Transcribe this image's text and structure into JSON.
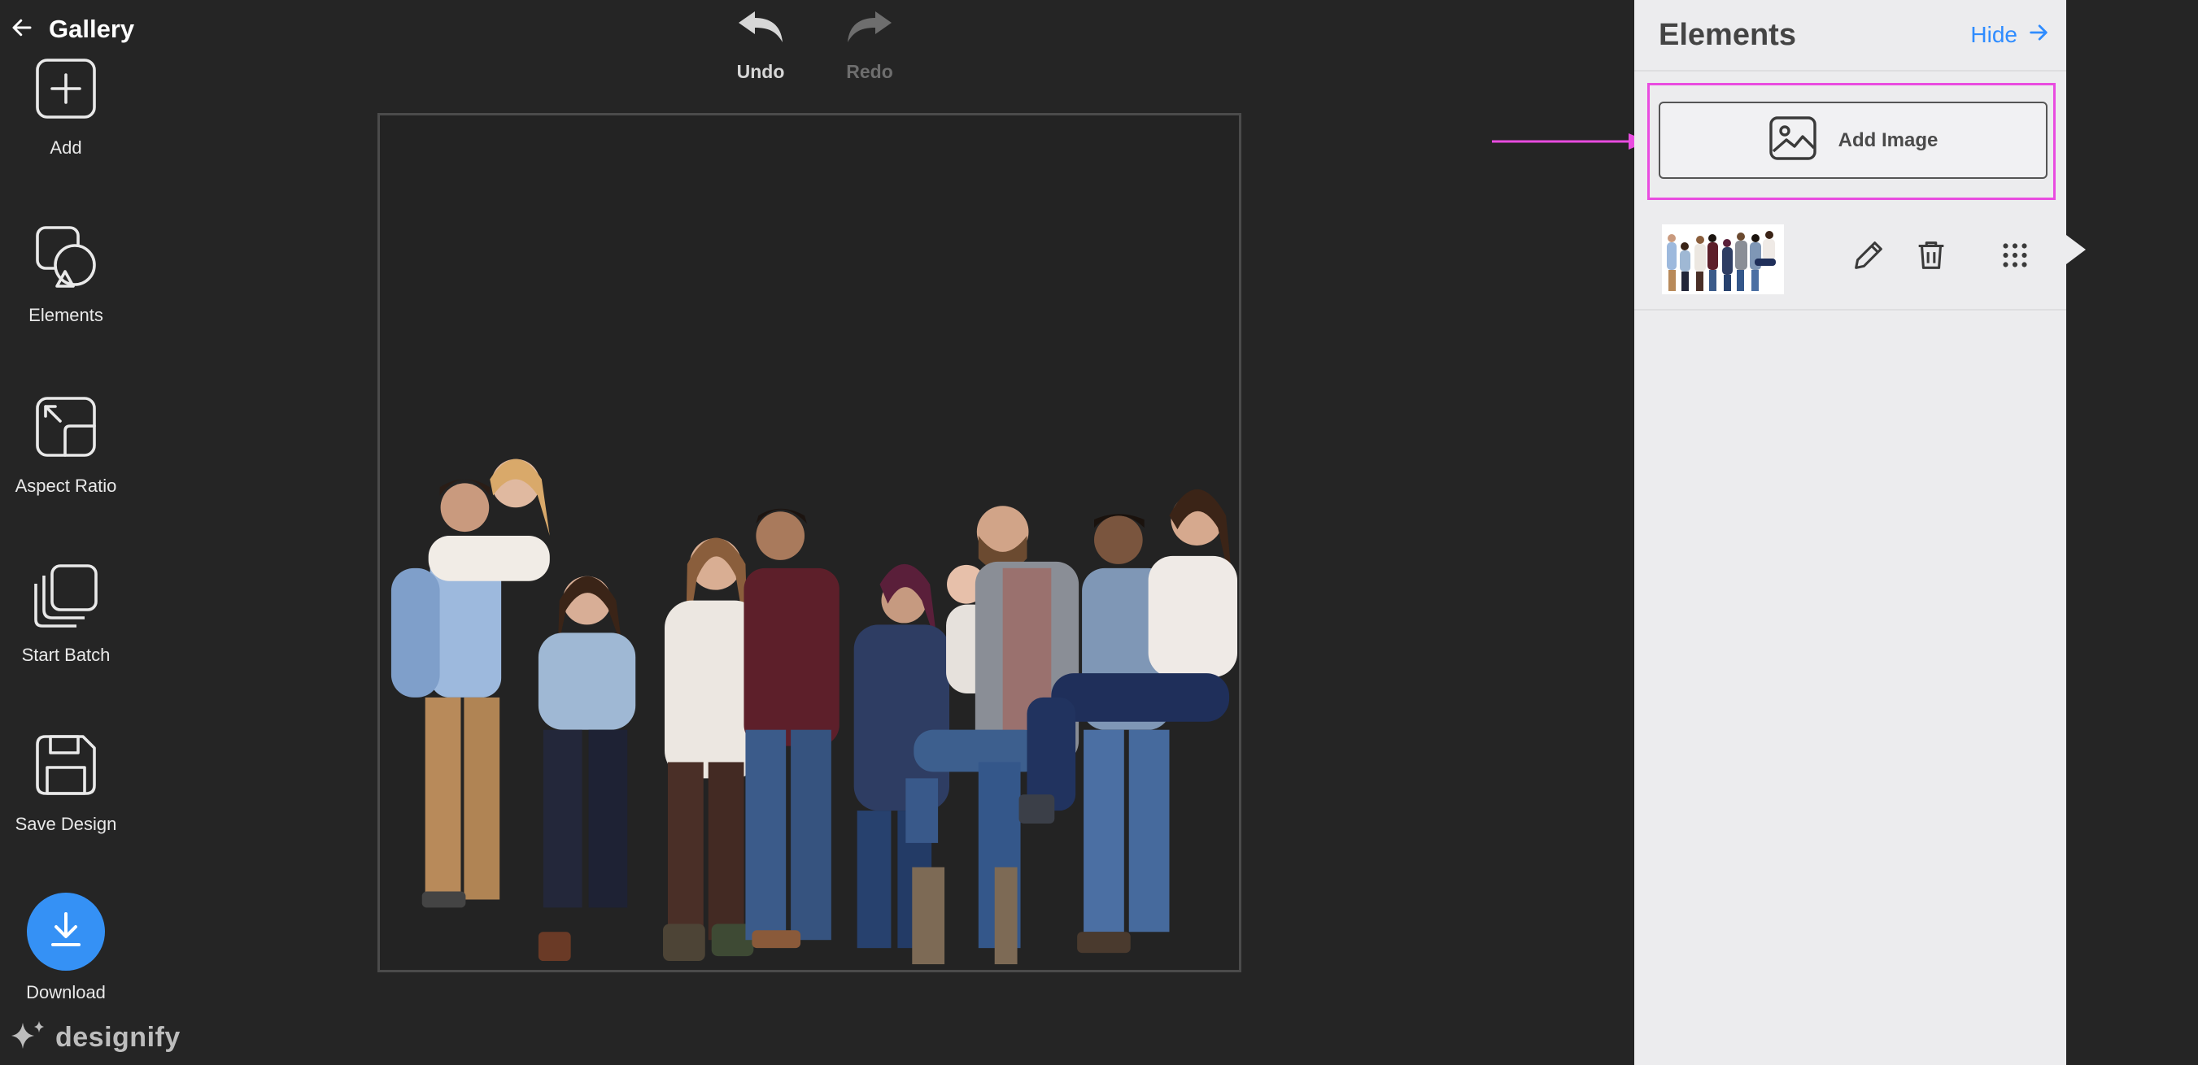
{
  "nav": {
    "back_label": "Gallery"
  },
  "history": {
    "undo_label": "Undo",
    "redo_label": "Redo",
    "redo_enabled": false
  },
  "panel": {
    "title": "Elements",
    "hide_label": "Hide",
    "add_image_label": "Add Image",
    "elements": [
      {
        "type": "image",
        "thumbnail": "group-photo",
        "actions": [
          "edit-icon",
          "trash-icon",
          "drag-handle-icon"
        ]
      }
    ]
  },
  "toolbar": {
    "items": [
      {
        "label": "Add",
        "icon": "plus-square-icon"
      },
      {
        "label": "Elements",
        "icon": "shapes-icon",
        "active": true
      },
      {
        "label": "Aspect Ratio",
        "icon": "aspect-ratio-icon"
      },
      {
        "label": "Start Batch",
        "icon": "stack-icon"
      },
      {
        "label": "Save Design",
        "icon": "floppy-disk-icon"
      },
      {
        "label": "Download",
        "icon": "download-icon"
      }
    ]
  },
  "brand": {
    "name": "designify"
  },
  "colors": {
    "accent": "#3591f5",
    "highlight": "#e94ce0",
    "link": "#2f8cff",
    "panel_bg": "#ececee",
    "app_bg": "#252525"
  }
}
